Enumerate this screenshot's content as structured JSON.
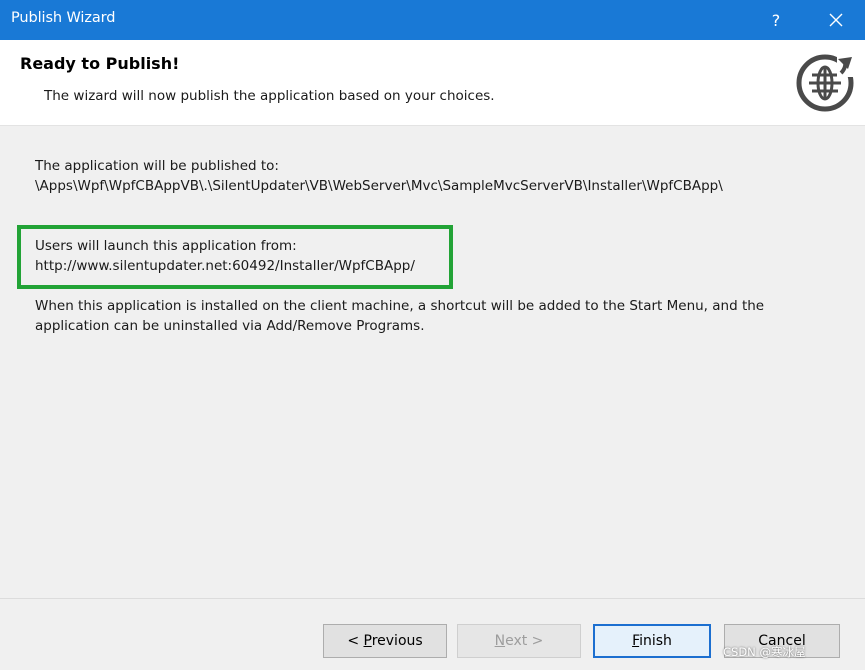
{
  "window": {
    "title": "Publish Wizard",
    "help_label": "?"
  },
  "header": {
    "title": "Ready to Publish!",
    "subtitle": "The wizard will now publish the application based on your choices."
  },
  "content": {
    "publish_to_label": "The application will be published to:",
    "publish_to_path": "\\Apps\\Wpf\\WpfCBAppVB\\.\\SilentUpdater\\VB\\WebServer\\Mvc\\SampleMvcServerVB\\Installer\\WpfCBApp\\",
    "launch_from_label": "Users will launch this application from:",
    "launch_from_url": "http://www.silentupdater.net:60492/Installer/WpfCBApp/",
    "install_note_line1": "When this application is installed on the client machine, a shortcut will be added to the Start Menu, and the",
    "install_note_line2": "application can be uninstalled via Add/Remove Programs."
  },
  "buttons": {
    "previous": {
      "prefix": "< ",
      "mnemonic": "P",
      "rest": "revious"
    },
    "next": {
      "mnemonic": "N",
      "rest": "ext >"
    },
    "finish": {
      "mnemonic": "F",
      "rest": "inish"
    },
    "cancel": {
      "label": "Cancel"
    }
  },
  "watermark": "CSDN @寒冰屋",
  "colors": {
    "titlebar": "#1979d6",
    "highlight_border": "#22a336",
    "default_button_border": "#1c6fd0"
  },
  "icons": {
    "header_icon": "globe-with-refresh-arrow-icon",
    "close": "close-icon"
  }
}
